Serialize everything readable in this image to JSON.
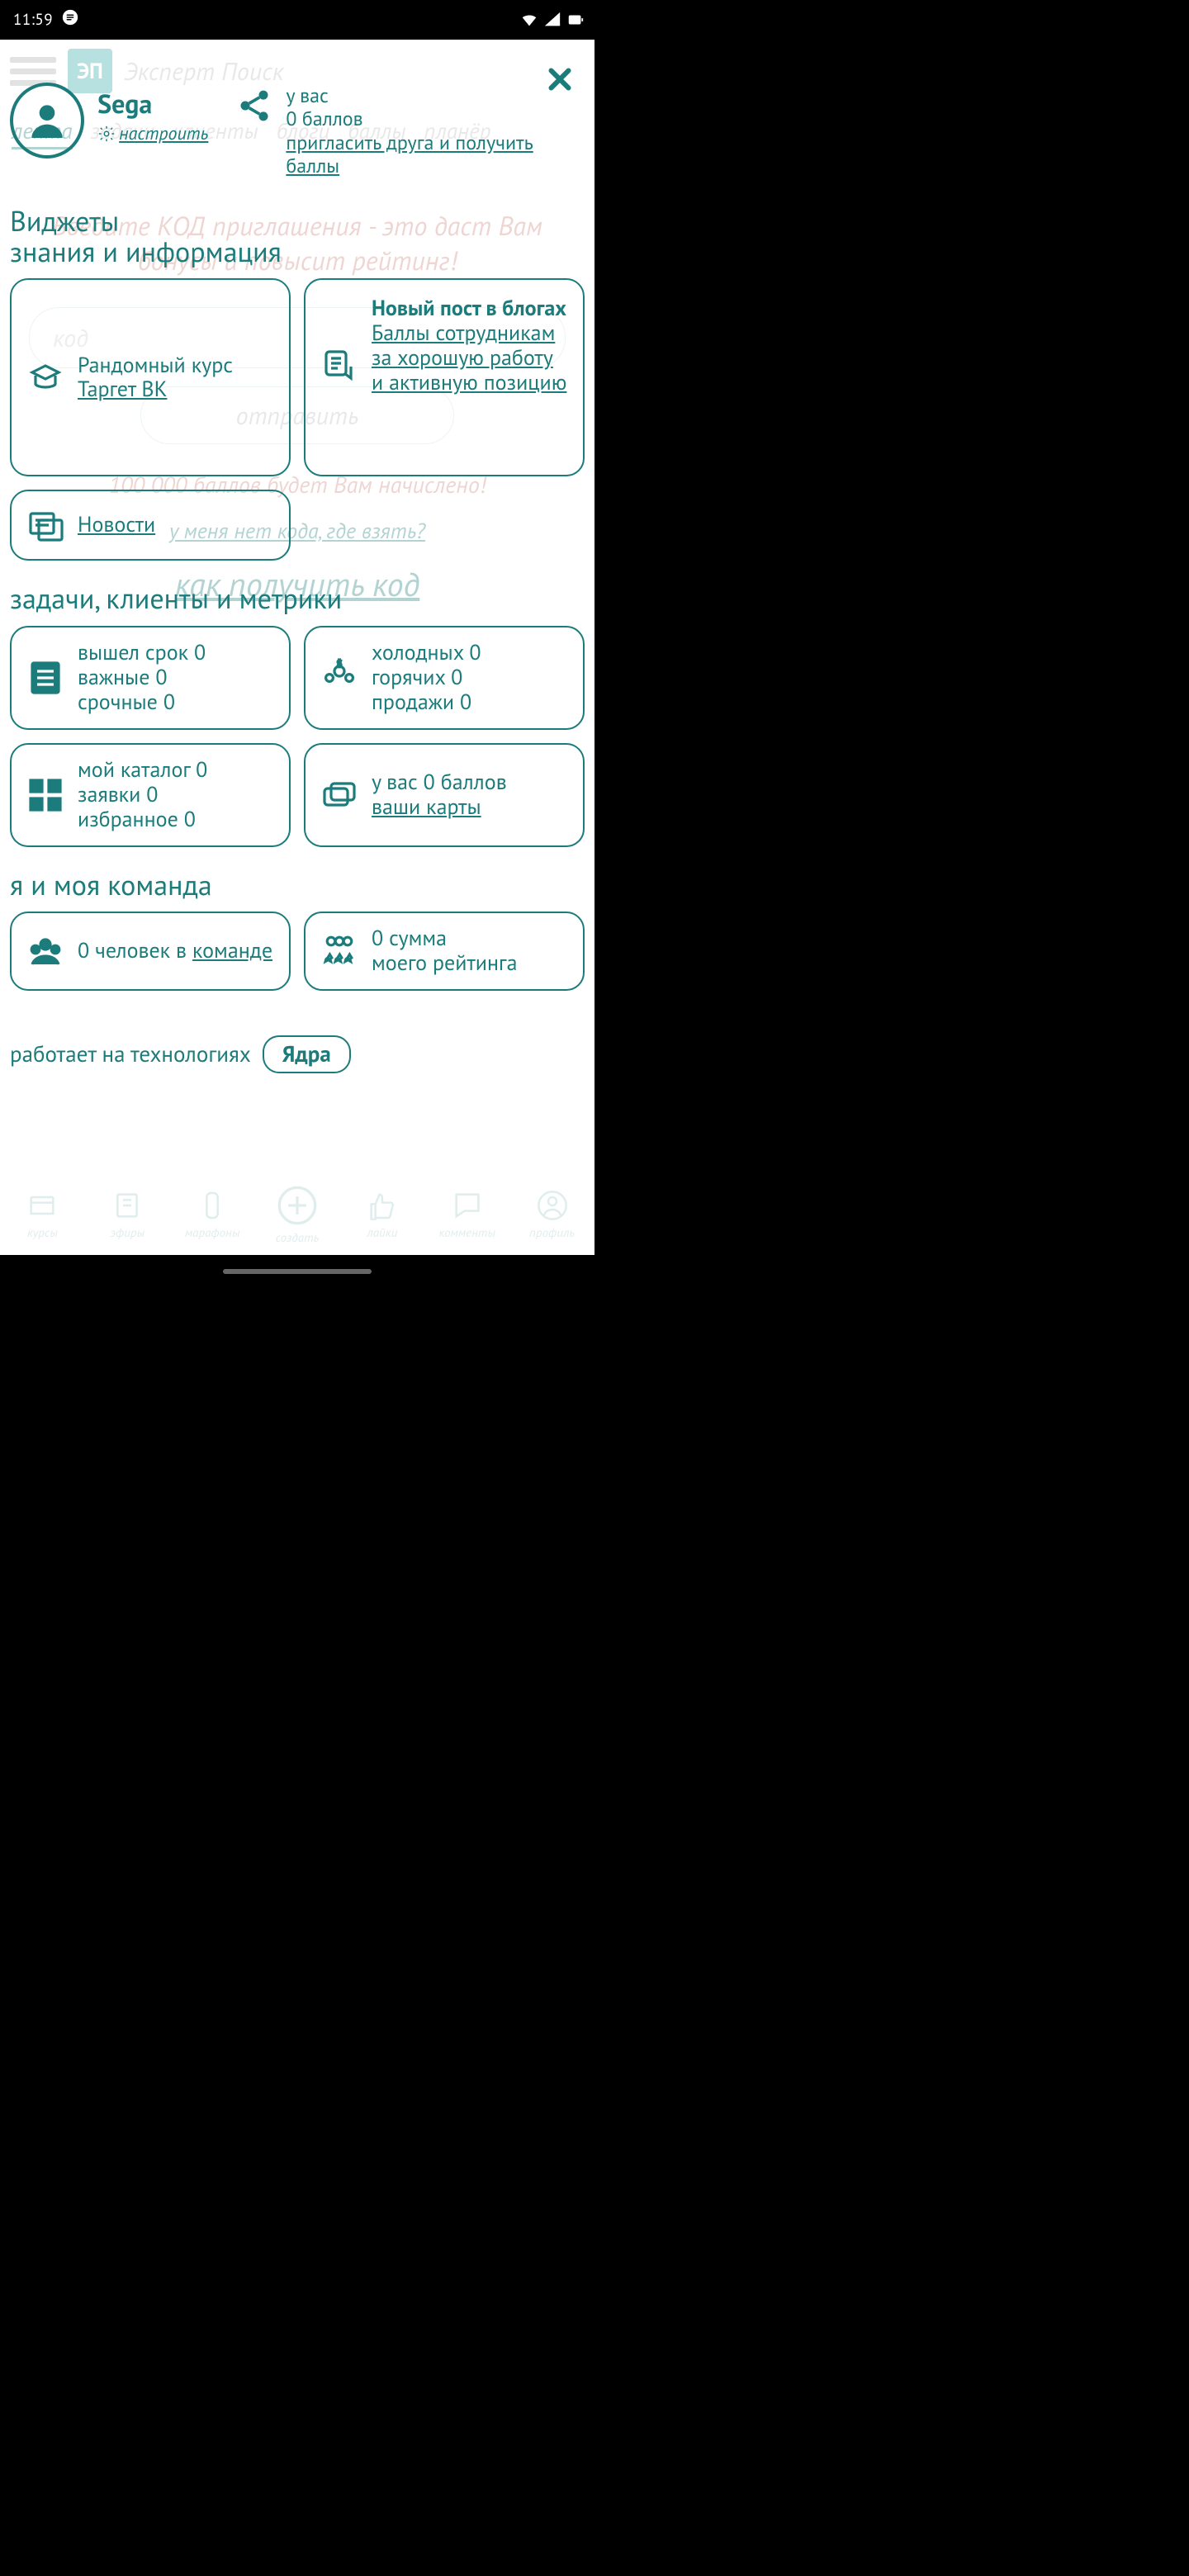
{
  "status": {
    "time": "11:59",
    "notif_icon": "chat-bubble"
  },
  "background": {
    "logo_text": "ЭП",
    "search_placeholder": "Эксперт Поиск",
    "tabs": [
      "лента",
      "задачи",
      "клиенты",
      "блоги",
      "баллы",
      "планёр"
    ],
    "invite_heading": "Введите КОД приглашения - это даст Вам бонусы и повысит рейтинг!",
    "code_placeholder": "код",
    "send_button": "отправить",
    "bonus_text": "100 000 баллов будет Вам начислено!",
    "no_code_link": "у меня нет кода, где взять?",
    "howto_link": "как получить код"
  },
  "bottom_nav": [
    {
      "label": "курсы",
      "name": "courses-icon"
    },
    {
      "label": "эфиры",
      "name": "streams-icon"
    },
    {
      "label": "марафоны",
      "name": "marathons-icon"
    },
    {
      "label": "создать",
      "name": "create-icon"
    },
    {
      "label": "лайки",
      "name": "likes-icon"
    },
    {
      "label": "комменты",
      "name": "comments-icon"
    },
    {
      "label": "профиль",
      "name": "profile-icon"
    }
  ],
  "overlay": {
    "profile": {
      "name": "Sega",
      "settings": "настроить"
    },
    "points": {
      "line1": "у вас",
      "line2": "0 баллов",
      "invite_link": "пригласить друга и получить баллы"
    },
    "sections": {
      "widgets_title": "Виджеты\nзнания и информация",
      "tasks_title": "задачи, клиенты и метрики",
      "team_title": "я и моя команда"
    },
    "widgets": {
      "course": {
        "title": "Рандомный курс",
        "link": "Таргет ВК"
      },
      "blog": {
        "title": "Новый пост в блогах",
        "link": "Баллы сотрудникам за хорошую работу и активную позицию"
      },
      "news": {
        "link": "Новости"
      }
    },
    "tasks": {
      "expired": "вышел срок 0",
      "important": "важные 0",
      "urgent": "срочные 0",
      "cold": "холодных 0",
      "hot": "горячих 0",
      "sales": "продажи 0",
      "catalog": "мой каталог 0",
      "requests": "заявки 0",
      "fav": "избранное 0",
      "points": "у вас 0 баллов",
      "cards_link": "ваши карты"
    },
    "team": {
      "team_count": "0 человек в",
      "team_link": "команде",
      "rating_sum": "0 сумма",
      "rating_label": "моего рейтинга"
    },
    "footer": {
      "prefix": "работает на технологиях",
      "pill": "Ядра"
    }
  }
}
